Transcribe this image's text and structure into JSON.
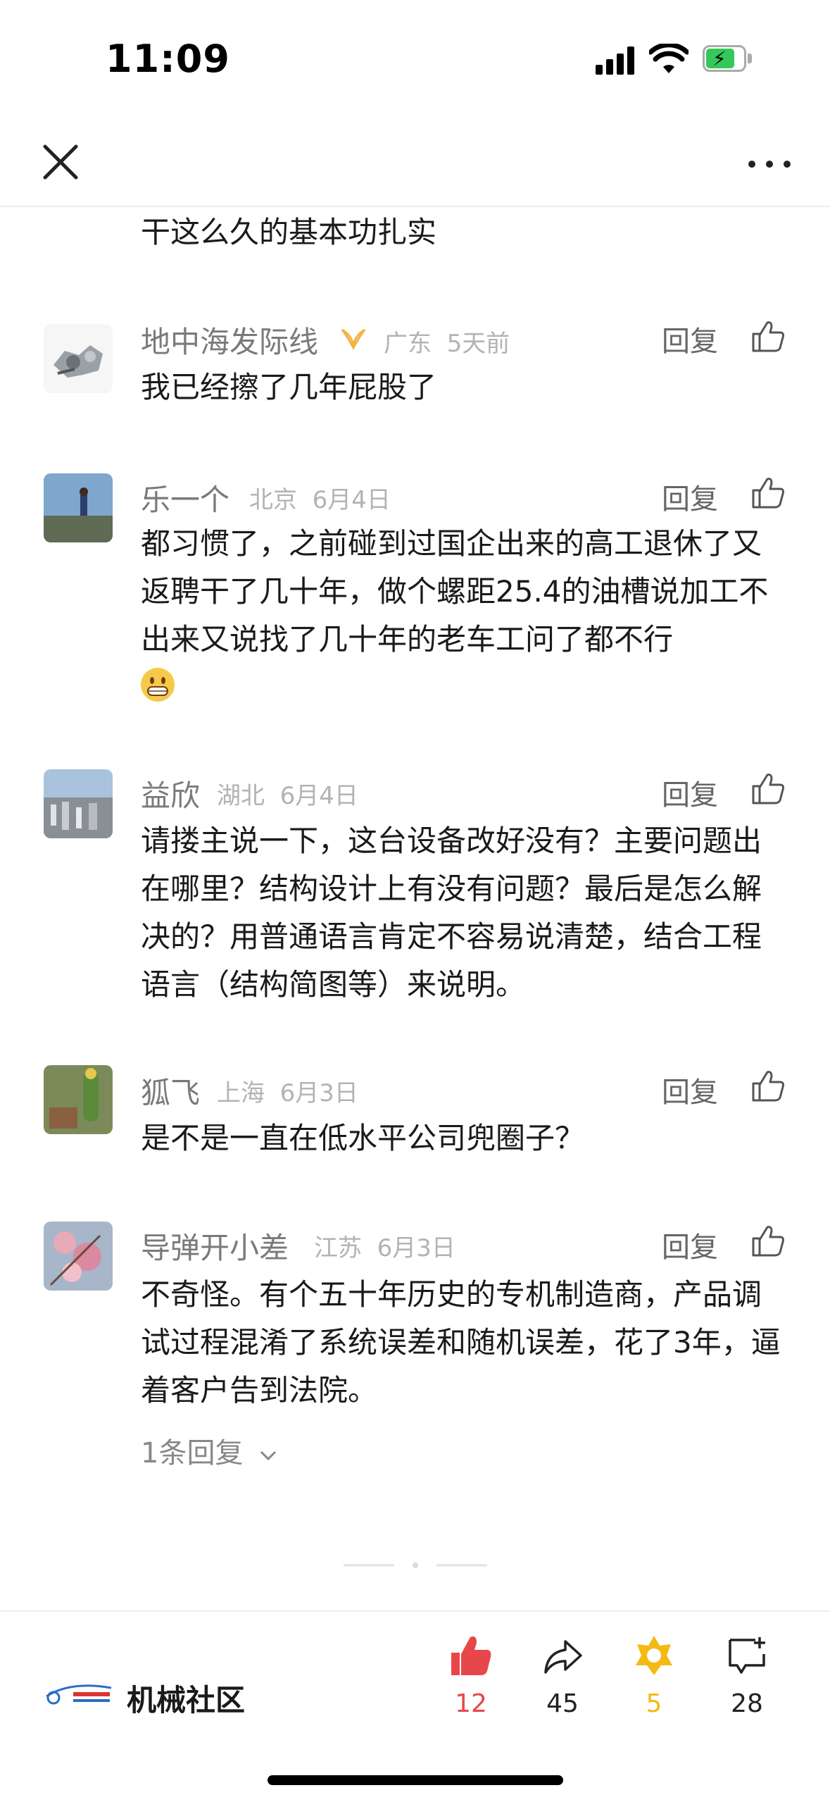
{
  "status_bar": {
    "time": "11:09"
  },
  "partial_comment": {
    "text": "干这么久的基本功扎实"
  },
  "comments": [
    {
      "name": "地中海发际线",
      "region": "广东",
      "date": "5天前",
      "reply_label": "回复",
      "text": "我已经擦了几年屁股了"
    },
    {
      "name": "乐一个",
      "region": "北京",
      "date": "6月4日",
      "reply_label": "回复",
      "text": "都习惯了，之前碰到过国企出来的高工退休了又返聘干了几十年，做个螺距25.4的油槽说加工不出来又说找了几十年的老车工问了都不行"
    },
    {
      "name": "益欣",
      "region": "湖北",
      "date": "6月4日",
      "reply_label": "回复",
      "text": "请搂主说一下，这台设备改好没有？主要问题出在哪里？结构设计上有没有问题？最后是怎么解决的？用普通语言肯定不容易说清楚，结合工程语言（结构简图等）来说明。"
    },
    {
      "name": "狐飞",
      "region": "上海",
      "date": "6月3日",
      "reply_label": "回复",
      "text": "是不是一直在低水平公司兜圈子？"
    },
    {
      "name": "导弹开小差",
      "region": "江苏",
      "date": "6月3日",
      "reply_label": "回复",
      "text": "不奇怪。有个五十年历史的专机制造商，产品调试过程混淆了系统误差和随机误差，花了3年，逼着客户告到法院。",
      "replies_link": "1条回复"
    }
  ],
  "bottom_bar": {
    "community_name": "机械社区",
    "like_count": "12",
    "share_count": "45",
    "collect_count": "5",
    "comment_count": "28"
  },
  "colors": {
    "like": "#e8474a",
    "collect": "#f5b914",
    "muted": "#8a8a8a"
  },
  "icons": [
    "close-icon",
    "more-icon",
    "thumb-up-icon",
    "share-icon",
    "star-icon",
    "comment-add-icon",
    "grin-emoji-icon"
  ]
}
